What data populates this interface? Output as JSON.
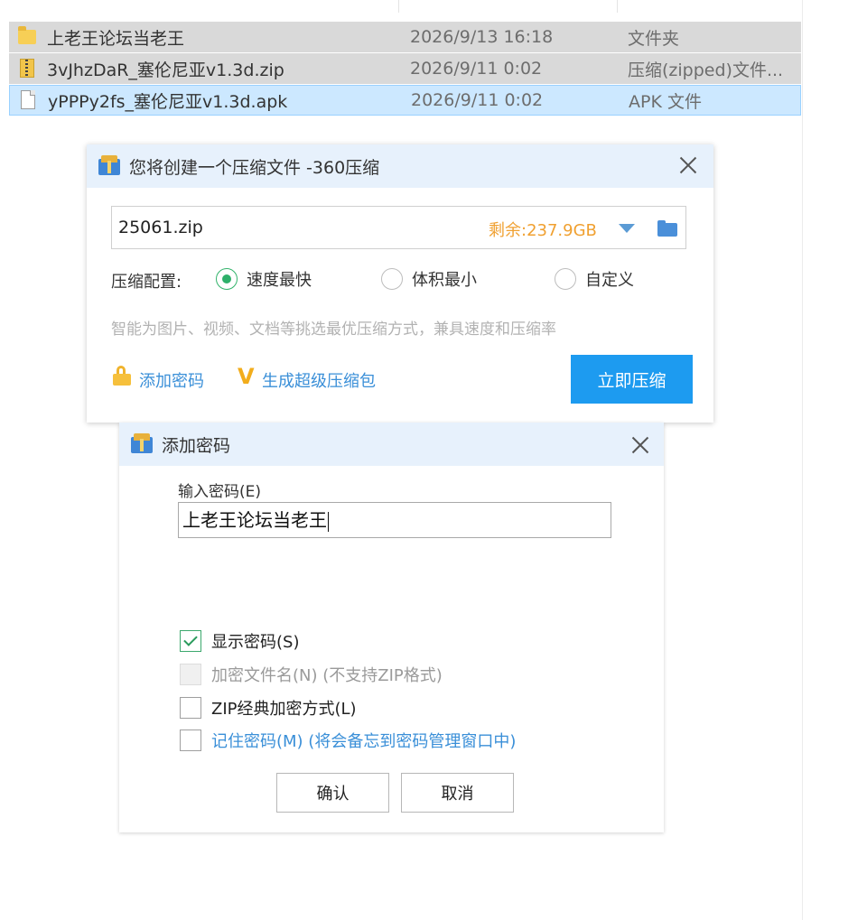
{
  "files": [
    {
      "name": "上老王论坛当老王",
      "date": "2026/9/13 16:18",
      "type": "文件夹",
      "icon": "folder-icon"
    },
    {
      "name": "3vJhzDaR_塞伦尼亚v1.3d.zip",
      "date": "2026/9/11 0:02",
      "type": "压缩(zipped)文件...",
      "icon": "zip-file-icon"
    },
    {
      "name": "yPPPy2fs_塞伦尼亚v1.3d.apk",
      "date": "2026/9/11 0:02",
      "type": "APK 文件",
      "icon": "file-icon"
    }
  ],
  "compress_dialog": {
    "title": "您将创建一个压缩文件 -360压缩",
    "filename": "25061.zip",
    "free_space": "剩余:237.9GB",
    "config_label": "压缩配置:",
    "options": [
      "速度最快",
      "体积最小",
      "自定义"
    ],
    "selected_option": "速度最快",
    "hint": "智能为图片、视频、文档等挑选最优压缩方式，兼具速度和压缩率",
    "add_password": "添加密码",
    "super_pack": "生成超级压缩包",
    "compress_now": "立即压缩"
  },
  "password_dialog": {
    "title": "添加密码",
    "input_label": "输入密码(E)",
    "password_value": "上老王论坛当老王",
    "show_password": "显示密码(S)",
    "encrypt_filenames": "加密文件名(N) (不支持ZIP格式)",
    "zip_classic": "ZIP经典加密方式(L)",
    "remember_password": "记住密码(M) (将会备忘到密码管理窗口中)",
    "confirm": "确认",
    "cancel": "取消",
    "checks": {
      "show_password": true,
      "encrypt_filenames": false,
      "zip_classic": false,
      "remember_password": false
    }
  },
  "colors": {
    "accent": "#1d9bf0",
    "free_space": "#f0a030",
    "link": "#3a8fd8",
    "radio_selected": "#2eb06a",
    "titlebar": "#e7f1fc",
    "selection": "#cce8ff"
  }
}
